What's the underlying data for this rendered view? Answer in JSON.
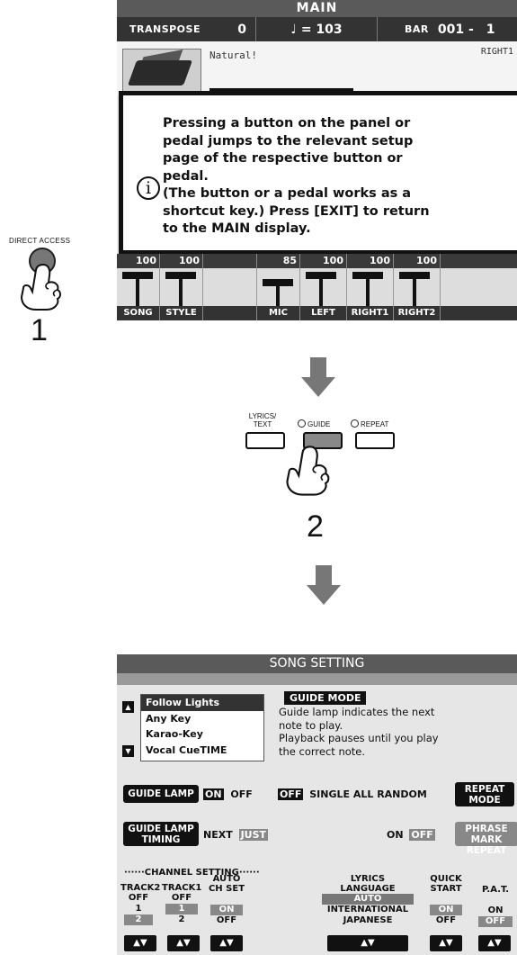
{
  "main": {
    "title": "MAIN",
    "transpose_label": "TRANSPOSE",
    "transpose_value": "0",
    "tempo_value": "♩ = 103",
    "bar_label": "BAR",
    "bar_value": "001 -",
    "beat_value": "1",
    "voice_name": "Natural!",
    "part_label": "RIGHT1",
    "message": "Pressing a button on the panel or\npedal jumps to the relevant setup\npage of the respective button or\npedal.\n(The button or a pedal works as a\nshortcut key.) Press [EXIT] to return\nto the MAIN display.",
    "mixer": {
      "levels": [
        "100",
        "100",
        "",
        "85",
        "100",
        "100",
        "100",
        ""
      ],
      "level_values": [
        100,
        100,
        0,
        85,
        100,
        100,
        100,
        0
      ],
      "names": [
        "SONG",
        "STYLE",
        "",
        "MIC",
        "LEFT",
        "RIGHT1",
        "RIGHT2",
        ""
      ]
    }
  },
  "direct_access": {
    "label": "DIRECT ACCESS",
    "step": "1"
  },
  "panel": {
    "lyrics_label": "LYRICS/\nTEXT",
    "guide_label": "GUIDE",
    "repeat_label": "REPEAT",
    "step": "2"
  },
  "song_setting": {
    "title": "SONG SETTING",
    "guide_modes": [
      "Follow Lights",
      "Any Key",
      "Karao-Key",
      "Vocal CueTIME"
    ],
    "guide_mode_title": "GUIDE MODE",
    "guide_mode_desc": "Guide lamp indicates the next\nnote to play.\nPlayback pauses until you play\nthe correct note.",
    "guide_lamp": "GUIDE LAMP",
    "on": "ON",
    "off": "OFF",
    "repeat_off": "OFF",
    "repeat_options": "SINGLE ALL RANDOM",
    "repeat_mode": "REPEAT\nMODE",
    "guide_lamp_timing": "GUIDE LAMP\nTIMING",
    "next": "NEXT",
    "just": "JUST",
    "phrase_on": "ON",
    "phrase_off": "OFF",
    "phrase_mark_repeat": "PHRASE MARK\nREPEAT",
    "channel_setting": "······CHANNEL SETTING······",
    "track2": "TRACK2",
    "track1": "TRACK1",
    "auto_ch_set": "AUTO\nCH SET",
    "track2_off": "OFF",
    "track2_1": "1",
    "track2_2": "2",
    "track1_off": "OFF",
    "track1_1": "1",
    "track1_2": "2",
    "auto_on": "ON",
    "auto_off": "OFF",
    "lyrics_language": "LYRICS\nLANGUAGE",
    "lyrics_auto": "AUTO",
    "lyrics_international": "INTERNATIONAL",
    "lyrics_japanese": "JAPANESE",
    "quick_start": "QUICK\nSTART",
    "quick_on": "ON",
    "quick_off": "OFF",
    "pat": "P.A.T.",
    "pat_on": "ON",
    "pat_off": "OFF"
  }
}
